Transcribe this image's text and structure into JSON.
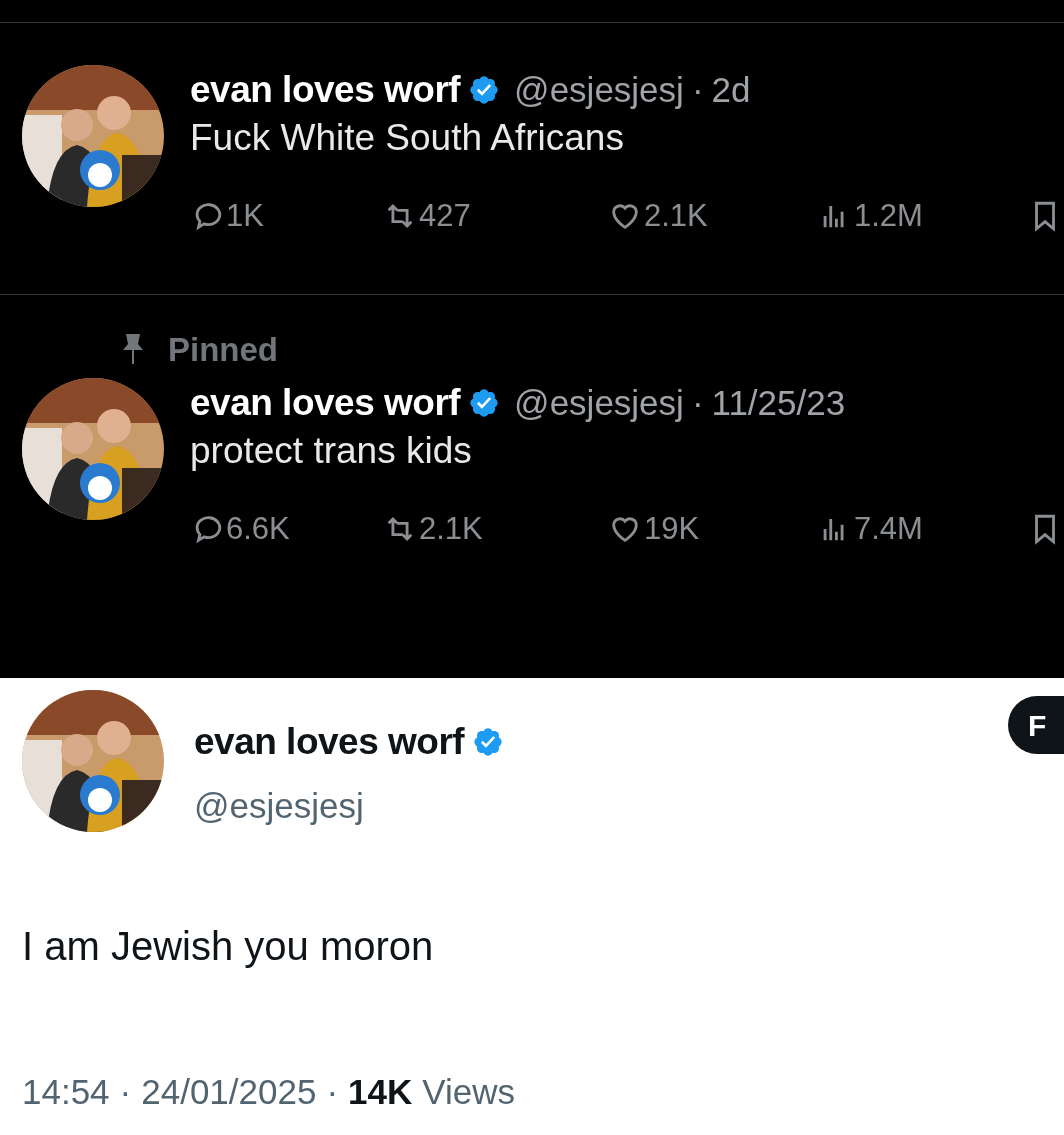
{
  "tweets": [
    {
      "name": "evan loves worf",
      "verified": true,
      "handle": "@esjesjesj",
      "separator": "·",
      "time": "2d",
      "text": "Fuck White South Africans",
      "stats": [
        {
          "kind": "reply",
          "value": "1K"
        },
        {
          "kind": "repost",
          "value": "427"
        },
        {
          "kind": "like",
          "value": "2.1K"
        },
        {
          "kind": "views",
          "value": "1.2M"
        },
        {
          "kind": "bookmark"
        }
      ]
    },
    {
      "pinned_label": "Pinned",
      "name": "evan loves worf",
      "verified": true,
      "handle": "@esjesjesj",
      "separator": "·",
      "time": "11/25/23",
      "text": "protect trans kids",
      "stats": [
        {
          "kind": "reply",
          "value": "6.6K"
        },
        {
          "kind": "repost",
          "value": "2.1K"
        },
        {
          "kind": "like",
          "value": "19K"
        },
        {
          "kind": "views",
          "value": "7.4M"
        },
        {
          "kind": "bookmark"
        }
      ]
    }
  ],
  "post": {
    "name": "evan loves worf",
    "verified": true,
    "handle": "@esjesjesj",
    "button": "F",
    "text": "I am Jewish you moron",
    "time": "14:54",
    "date": "24/01/2025",
    "separator": "·",
    "views_count": "14K",
    "views_label": "Views"
  }
}
